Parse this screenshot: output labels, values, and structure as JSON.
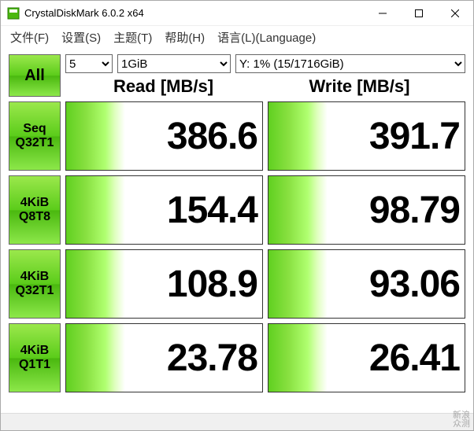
{
  "window": {
    "title": "CrystalDiskMark 6.0.2 x64"
  },
  "menu": {
    "file": "文件(F)",
    "settings": "设置(S)",
    "theme": "主题(T)",
    "help": "帮助(H)",
    "language": "语言(L)(Language)"
  },
  "controls": {
    "all": "All",
    "count": "5",
    "size": "1GiB",
    "drive": "Y: 1% (15/1716GiB)"
  },
  "headers": {
    "read": "Read [MB/s]",
    "write": "Write [MB/s]"
  },
  "tests": [
    {
      "label1": "Seq",
      "label2": "Q32T1",
      "read": "386.6",
      "write": "391.7"
    },
    {
      "label1": "4KiB",
      "label2": "Q8T8",
      "read": "154.4",
      "write": "98.79"
    },
    {
      "label1": "4KiB",
      "label2": "Q32T1",
      "read": "108.9",
      "write": "93.06"
    },
    {
      "label1": "4KiB",
      "label2": "Q1T1",
      "read": "23.78",
      "write": "26.41"
    }
  ],
  "watermark": {
    "line1": "新浪",
    "line2": "众测"
  }
}
